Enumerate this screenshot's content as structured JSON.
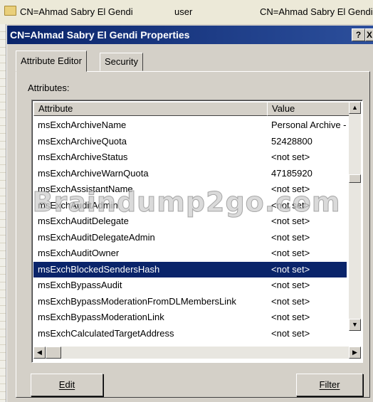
{
  "background_row": {
    "name": "CN=Ahmad Sabry El Gendi",
    "type": "user",
    "dn": "CN=Ahmad Sabry El Gendi"
  },
  "dialog": {
    "title": "CN=Ahmad Sabry El Gendi Properties",
    "help_button": "?",
    "close_button": "X",
    "tabs": [
      {
        "label": "Attribute Editor",
        "active": true
      },
      {
        "label": "Security",
        "active": false
      }
    ],
    "attributes_label": "Attributes:",
    "columns": {
      "attribute": "Attribute",
      "value": "Value"
    },
    "rows": [
      {
        "attribute": "msExchArchiveName",
        "value": "Personal Archive -"
      },
      {
        "attribute": "msExchArchiveQuota",
        "value": "52428800"
      },
      {
        "attribute": "msExchArchiveStatus",
        "value": "<not set>"
      },
      {
        "attribute": "msExchArchiveWarnQuota",
        "value": "47185920"
      },
      {
        "attribute": "msExchAssistantName",
        "value": "<not set>"
      },
      {
        "attribute": "msExchAuditAdmin",
        "value": "<not set>"
      },
      {
        "attribute": "msExchAuditDelegate",
        "value": "<not set>"
      },
      {
        "attribute": "msExchAuditDelegateAdmin",
        "value": "<not set>"
      },
      {
        "attribute": "msExchAuditOwner",
        "value": "<not set>"
      },
      {
        "attribute": "msExchBlockedSendersHash",
        "value": "<not set>",
        "selected": true
      },
      {
        "attribute": "msExchBypassAudit",
        "value": "<not set>"
      },
      {
        "attribute": "msExchBypassModerationFromDLMembersLink",
        "value": "<not set>"
      },
      {
        "attribute": "msExchBypassModerationLink",
        "value": "<not set>"
      },
      {
        "attribute": "msExchCalculatedTargetAddress",
        "value": "<not set>"
      }
    ],
    "edit_button": "Edit",
    "filter_button": "Filter"
  },
  "watermark": "Braindump2go.com",
  "colors": {
    "selection": "#0a246a",
    "title_bar": "#0a246a",
    "face": "#d4d0c8"
  }
}
